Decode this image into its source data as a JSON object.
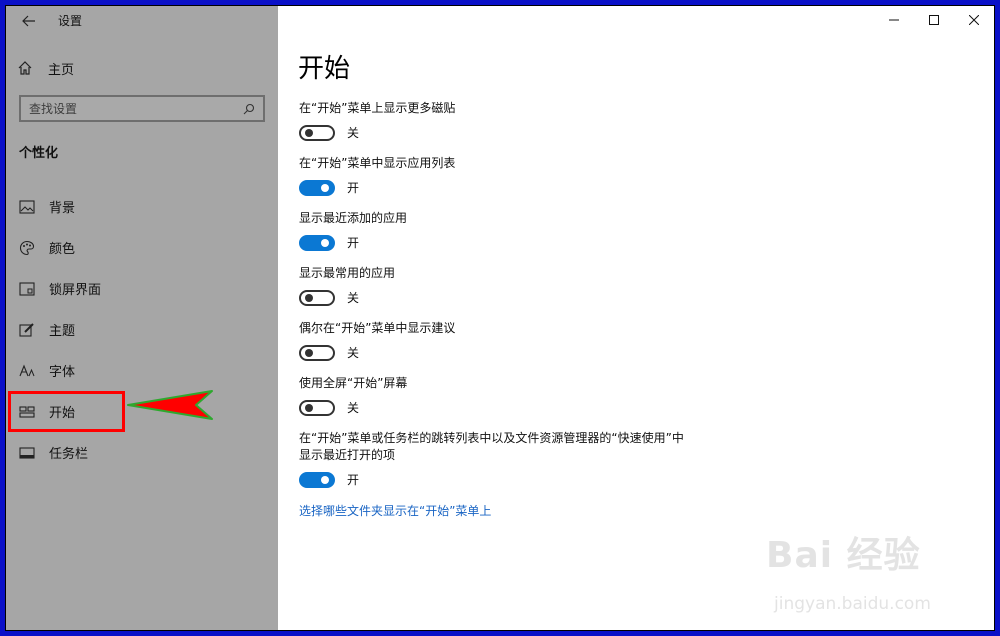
{
  "window": {
    "app_title": "设置"
  },
  "sidebar": {
    "home_label": "主页",
    "search_placeholder": "查找设置",
    "section_title": "个性化",
    "items": [
      {
        "label": "背景",
        "icon": "image-icon"
      },
      {
        "label": "颜色",
        "icon": "palette-icon"
      },
      {
        "label": "锁屏界面",
        "icon": "lock-screen-icon"
      },
      {
        "label": "主题",
        "icon": "theme-brush-icon"
      },
      {
        "label": "字体",
        "icon": "font-icon"
      },
      {
        "label": "开始",
        "icon": "start-menu-icon",
        "highlighted": true
      },
      {
        "label": "任务栏",
        "icon": "taskbar-icon"
      }
    ]
  },
  "main": {
    "page_title": "开始",
    "settings": [
      {
        "text": "在“开始”菜单上显示更多磁贴",
        "state": "关",
        "on": false
      },
      {
        "text": "在“开始”菜单中显示应用列表",
        "state": "开",
        "on": true
      },
      {
        "text": "显示最近添加的应用",
        "state": "开",
        "on": true
      },
      {
        "text": "显示最常用的应用",
        "state": "关",
        "on": false
      },
      {
        "text": "偶尔在“开始”菜单中显示建议",
        "state": "关",
        "on": false
      },
      {
        "text": "使用全屏“开始”屏幕",
        "state": "关",
        "on": false
      },
      {
        "text": "在“开始”菜单或任务栏的跳转列表中以及文件资源管理器的“快速使用”中显示最近打开的项",
        "state": "开",
        "on": true
      }
    ],
    "link_text": "选择哪些文件夹显示在“开始”菜单上"
  },
  "watermark": {
    "brand": "Bai 经验",
    "url": "jingyan.baidu.com"
  },
  "colors": {
    "accent": "#0b78d3",
    "sidebar_bg": "#a6a6a6",
    "annotation": "#ff0000",
    "frame": "#0a10c8"
  }
}
